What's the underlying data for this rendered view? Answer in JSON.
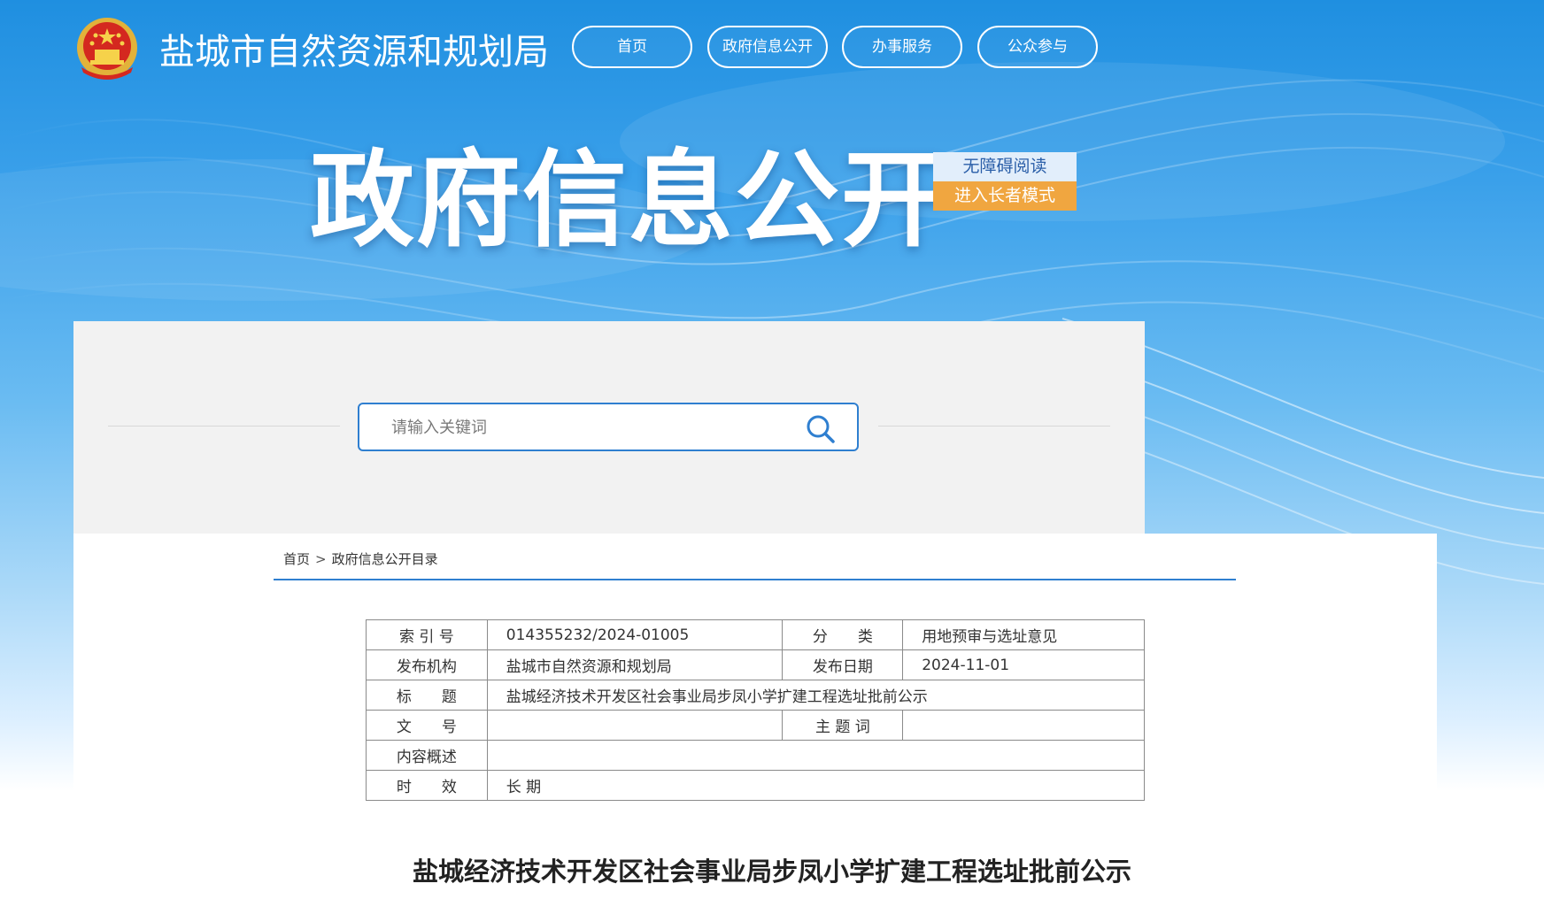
{
  "header": {
    "site_title": "盐城市自然资源和规划局",
    "nav": [
      {
        "label": "首页"
      },
      {
        "label": "政府信息公开"
      },
      {
        "label": "办事服务"
      },
      {
        "label": "公众参与"
      }
    ]
  },
  "hero": {
    "title": "政府信息公开",
    "accessibility_label": "无障碍阅读",
    "elder_mode_label": "进入长者模式"
  },
  "search": {
    "placeholder": "请输入关键词",
    "value": ""
  },
  "breadcrumb": {
    "items": [
      "首页",
      "政府信息公开目录"
    ],
    "separator": ">"
  },
  "meta_table": {
    "rows": [
      {
        "label1": "索 引 号",
        "value1": "014355232/2024-01005",
        "label2": "分　　类",
        "value2": "用地预审与选址意见"
      },
      {
        "label1": "发布机构",
        "value1": "盐城市自然资源和规划局",
        "label2": "发布日期",
        "value2": "2024-11-01"
      },
      {
        "label1": "标　　题",
        "value1": "盐城经济技术开发区社会事业局步凤小学扩建工程选址批前公示"
      },
      {
        "label1": "文　　号",
        "value1": "",
        "label2": "主 题 词",
        "value2": ""
      },
      {
        "label1": "内容概述",
        "value1": ""
      },
      {
        "label1": "时　　效",
        "value1": "长 期"
      }
    ]
  },
  "article": {
    "title": "盐城经济技术开发区社会事业局步凤小学扩建工程选址批前公示"
  },
  "colors": {
    "accent": "#2f7fd0",
    "elder_mode": "#f0a640",
    "accessibility_bg": "#e2eefb"
  },
  "icons": {
    "emblem": "national-emblem-icon",
    "search": "search-icon"
  }
}
